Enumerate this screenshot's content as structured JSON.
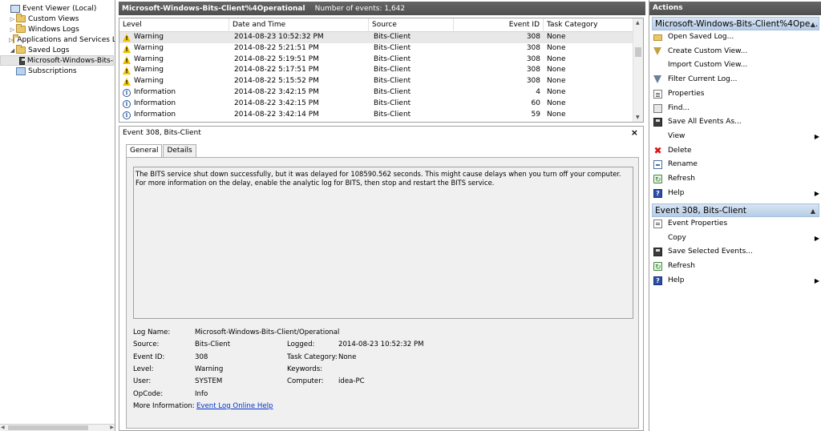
{
  "tree": {
    "items": [
      {
        "label": "Event Viewer (Local)",
        "arrow": "",
        "icon": "monitor",
        "indent": 0
      },
      {
        "label": "Custom Views",
        "arrow": "▷",
        "icon": "folder",
        "indent": 1
      },
      {
        "label": "Windows Logs",
        "arrow": "▷",
        "icon": "folder",
        "indent": 1
      },
      {
        "label": "Applications and Services Lo",
        "arrow": "▷",
        "icon": "folder",
        "indent": 1
      },
      {
        "label": "Saved Logs",
        "arrow": "◢",
        "icon": "folder",
        "indent": 1
      },
      {
        "label": "Microsoft-Windows-Bits-",
        "arrow": "",
        "icon": "savedlog",
        "indent": 2
      },
      {
        "label": "Subscriptions",
        "arrow": "",
        "icon": "subs",
        "indent": 1
      }
    ]
  },
  "center": {
    "title": "Microsoft-Windows-Bits-Client%4Operational",
    "event_count": "Number of events: 1,642",
    "columns": {
      "level": "Level",
      "datetime": "Date and Time",
      "source": "Source",
      "event_id": "Event ID",
      "task_category": "Task Category"
    },
    "rows": [
      {
        "level": "Warning",
        "type": "warning",
        "datetime": "2014-08-23 10:52:32 PM",
        "source": "Bits-Client",
        "event_id": "308",
        "task": "None",
        "selected": true
      },
      {
        "level": "Warning",
        "type": "warning",
        "datetime": "2014-08-22 5:21:51 PM",
        "source": "Bits-Client",
        "event_id": "308",
        "task": "None"
      },
      {
        "level": "Warning",
        "type": "warning",
        "datetime": "2014-08-22 5:19:51 PM",
        "source": "Bits-Client",
        "event_id": "308",
        "task": "None"
      },
      {
        "level": "Warning",
        "type": "warning",
        "datetime": "2014-08-22 5:17:51 PM",
        "source": "Bits-Client",
        "event_id": "308",
        "task": "None"
      },
      {
        "level": "Warning",
        "type": "warning",
        "datetime": "2014-08-22 5:15:52 PM",
        "source": "Bits-Client",
        "event_id": "308",
        "task": "None"
      },
      {
        "level": "Information",
        "type": "info",
        "datetime": "2014-08-22 3:42:15 PM",
        "source": "Bits-Client",
        "event_id": "4",
        "task": "None"
      },
      {
        "level": "Information",
        "type": "info",
        "datetime": "2014-08-22 3:42:15 PM",
        "source": "Bits-Client",
        "event_id": "60",
        "task": "None"
      },
      {
        "level": "Information",
        "type": "info",
        "datetime": "2014-08-22 3:42:14 PM",
        "source": "Bits-Client",
        "event_id": "59",
        "task": "None"
      }
    ]
  },
  "detail": {
    "title": "Event 308, Bits-Client",
    "close": "×",
    "tabs": {
      "general": "General",
      "details": "Details"
    },
    "message": "The BITS service shut down successfully, but it was delayed for 108590.562 seconds. This might cause delays when you turn off your computer. For more information on the delay, enable the analytic log for BITS, then stop and restart the BITS service.",
    "labels": {
      "log_name": "Log Name:",
      "source": "Source:",
      "event_id": "Event ID:",
      "level": "Level:",
      "user": "User:",
      "opcode": "OpCode:",
      "more_info": "More Information:",
      "logged": "Logged:",
      "task_category": "Task Category:",
      "keywords": "Keywords:",
      "computer": "Computer:"
    },
    "values": {
      "log_name": "Microsoft-Windows-Bits-Client/Operational",
      "source": "Bits-Client",
      "event_id": "308",
      "level": "Warning",
      "user": "SYSTEM",
      "opcode": "Info",
      "more_info_link": "Event Log Online Help",
      "logged": "2014-08-23 10:52:32 PM",
      "task_category": "None",
      "keywords": "",
      "computer": "idea-PC"
    }
  },
  "actions": {
    "header": "Actions",
    "section1": "Microsoft-Windows-Bits-Client%4Ope...",
    "section1_items": [
      {
        "label": "Open Saved Log...",
        "icon": "folder"
      },
      {
        "label": "Create Custom View...",
        "icon": "funnel-add"
      },
      {
        "label": "Import Custom View...",
        "icon": "blank"
      },
      {
        "label": "Filter Current Log...",
        "icon": "funnel"
      },
      {
        "label": "Properties",
        "icon": "props"
      },
      {
        "label": "Find...",
        "icon": "find"
      },
      {
        "label": "Save All Events As...",
        "icon": "save"
      },
      {
        "label": "View",
        "icon": "blank",
        "sub": true
      },
      {
        "label": "Delete",
        "icon": "delete"
      },
      {
        "label": "Rename",
        "icon": "rename"
      },
      {
        "label": "Refresh",
        "icon": "refresh"
      },
      {
        "label": "Help",
        "icon": "help",
        "sub": true
      }
    ],
    "section2": "Event 308, Bits-Client",
    "section2_items": [
      {
        "label": "Event Properties",
        "icon": "evprops"
      },
      {
        "label": "Copy",
        "icon": "copy",
        "sub": true
      },
      {
        "label": "Save Selected Events...",
        "icon": "save"
      },
      {
        "label": "Refresh",
        "icon": "refresh"
      },
      {
        "label": "Help",
        "icon": "help",
        "sub": true
      }
    ]
  },
  "colors": {
    "header_bg": "#5a5a5a",
    "section_bg": "#c6d8ec",
    "warning": "#f2c200",
    "info": "#2c5aa0",
    "link": "#0033cc"
  }
}
